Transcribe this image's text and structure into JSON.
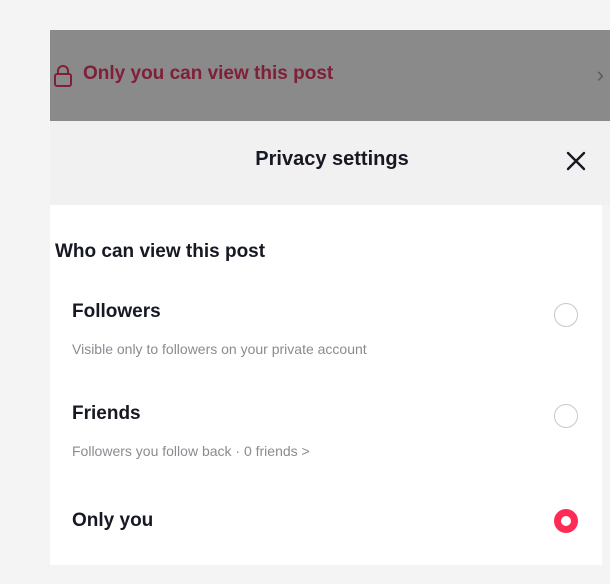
{
  "banner": {
    "text": "Only you can view this post",
    "icon": "lock-icon",
    "chevron": "›"
  },
  "header": {
    "title": "Privacy settings",
    "close_icon": "close-icon"
  },
  "section": {
    "title": "Who can view this post"
  },
  "options": [
    {
      "label": "Followers",
      "description": "Visible only to followers on your private account",
      "selected": false
    },
    {
      "label": "Friends",
      "description": "Followers you follow back · 0 friends >",
      "selected": false
    },
    {
      "label": "Only you",
      "description": "",
      "selected": true
    }
  ],
  "colors": {
    "accent": "#fe2c55",
    "banner_text": "#7e2037",
    "overlay": "#8a8a8a"
  }
}
